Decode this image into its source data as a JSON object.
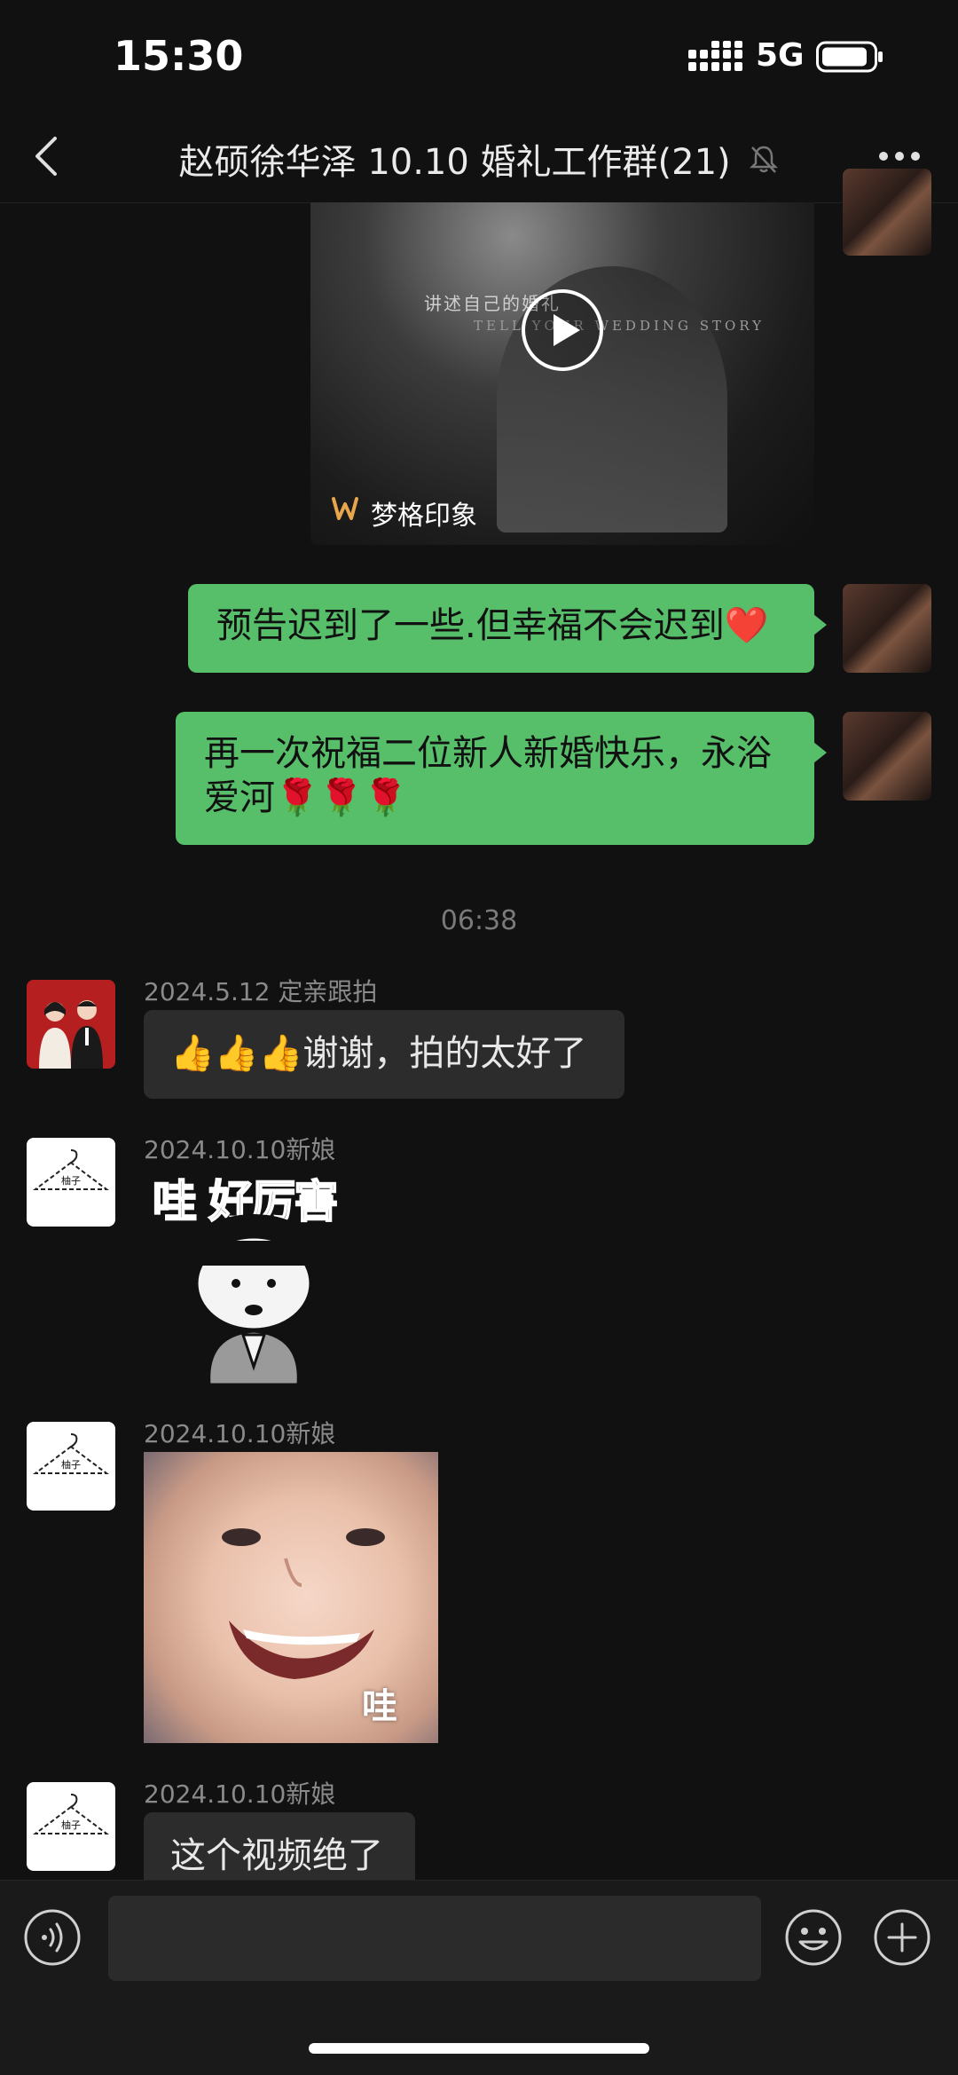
{
  "status_bar": {
    "time": "15:30",
    "network": "5G"
  },
  "header": {
    "title": "赵硕徐华泽 10.10 婚礼工作群(21)"
  },
  "video": {
    "brand": "梦格印象",
    "caption_cn": "讲述自己的婚礼",
    "caption_en": "TELL YOUR WEDDING STORY"
  },
  "messages": {
    "m1": {
      "text": "预告迟到了一些.但幸福不会迟到❤️"
    },
    "m2": {
      "line1": "再一次祝福二位新人新婚快乐，永浴",
      "line2": "爱河🌹🌹🌹"
    },
    "timestamp": "06:38",
    "m3": {
      "sender": "2024.5.12 定亲跟拍",
      "text": "👍👍👍谢谢，拍的太好了"
    },
    "m4": {
      "sender": "2024.10.10新娘",
      "sticker_text": "哇 好厉害"
    },
    "m5": {
      "sender": "2024.10.10新娘",
      "image_caption": "哇"
    },
    "m6": {
      "sender": "2024.10.10新娘",
      "text": "这个视频绝了"
    }
  },
  "avatar": {
    "hanger_label": "柚子"
  },
  "input_bar": {
    "placeholder": ""
  }
}
